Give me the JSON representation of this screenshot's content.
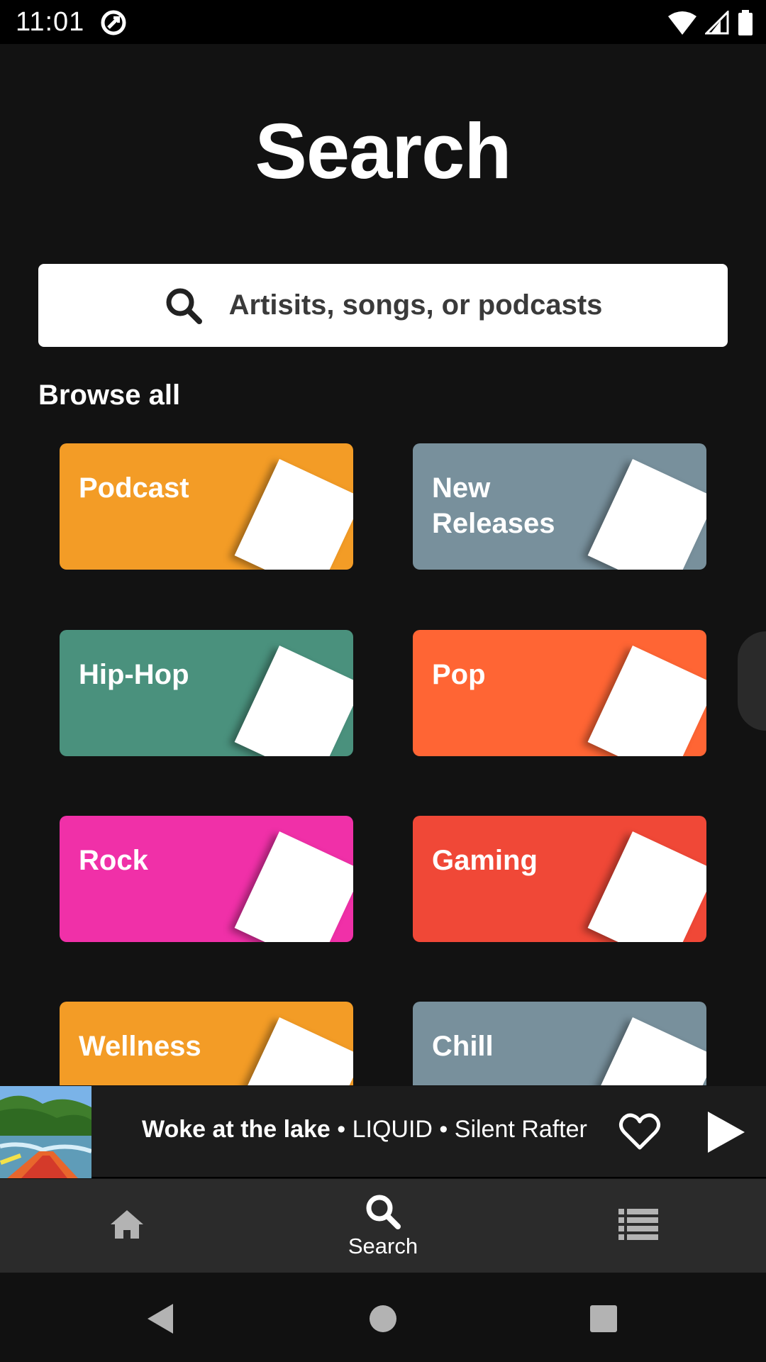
{
  "status_bar": {
    "time": "11:01"
  },
  "header": {
    "title": "Search"
  },
  "search": {
    "placeholder": "Artisits, songs, or podcasts"
  },
  "browse": {
    "heading": "Browse all",
    "categories": [
      {
        "label": "Podcast",
        "color": "#F39C26"
      },
      {
        "label": "New Releases",
        "color": "#78909C"
      },
      {
        "label": "Hip-Hop",
        "color": "#4A917D"
      },
      {
        "label": "Pop",
        "color": "#FF6534"
      },
      {
        "label": "Rock",
        "color": "#F030A8"
      },
      {
        "label": "Gaming",
        "color": "#F04837"
      },
      {
        "label": "Wellness",
        "color": "#F39C26"
      },
      {
        "label": "Chill",
        "color": "#78909C"
      }
    ]
  },
  "now_playing": {
    "song": "Woke at the lake",
    "separator1": " • ",
    "album": "LIQUID",
    "separator2": " • ",
    "artist": "Silent Rafter"
  },
  "bottom_nav": {
    "items": [
      {
        "label": "",
        "icon": "home-icon"
      },
      {
        "label": "Search",
        "icon": "search-icon"
      },
      {
        "label": "",
        "icon": "library-icon"
      }
    ]
  },
  "icons": {
    "wifi": "wifi-icon",
    "signal": "signal-icon",
    "battery": "battery-icon",
    "back": "back-icon",
    "home": "home-circle-icon",
    "recents": "recents-icon"
  },
  "colors": {
    "background": "#121212",
    "search_bg": "#FFFFFF",
    "bottom_nav_bg": "#2B2B2B"
  }
}
